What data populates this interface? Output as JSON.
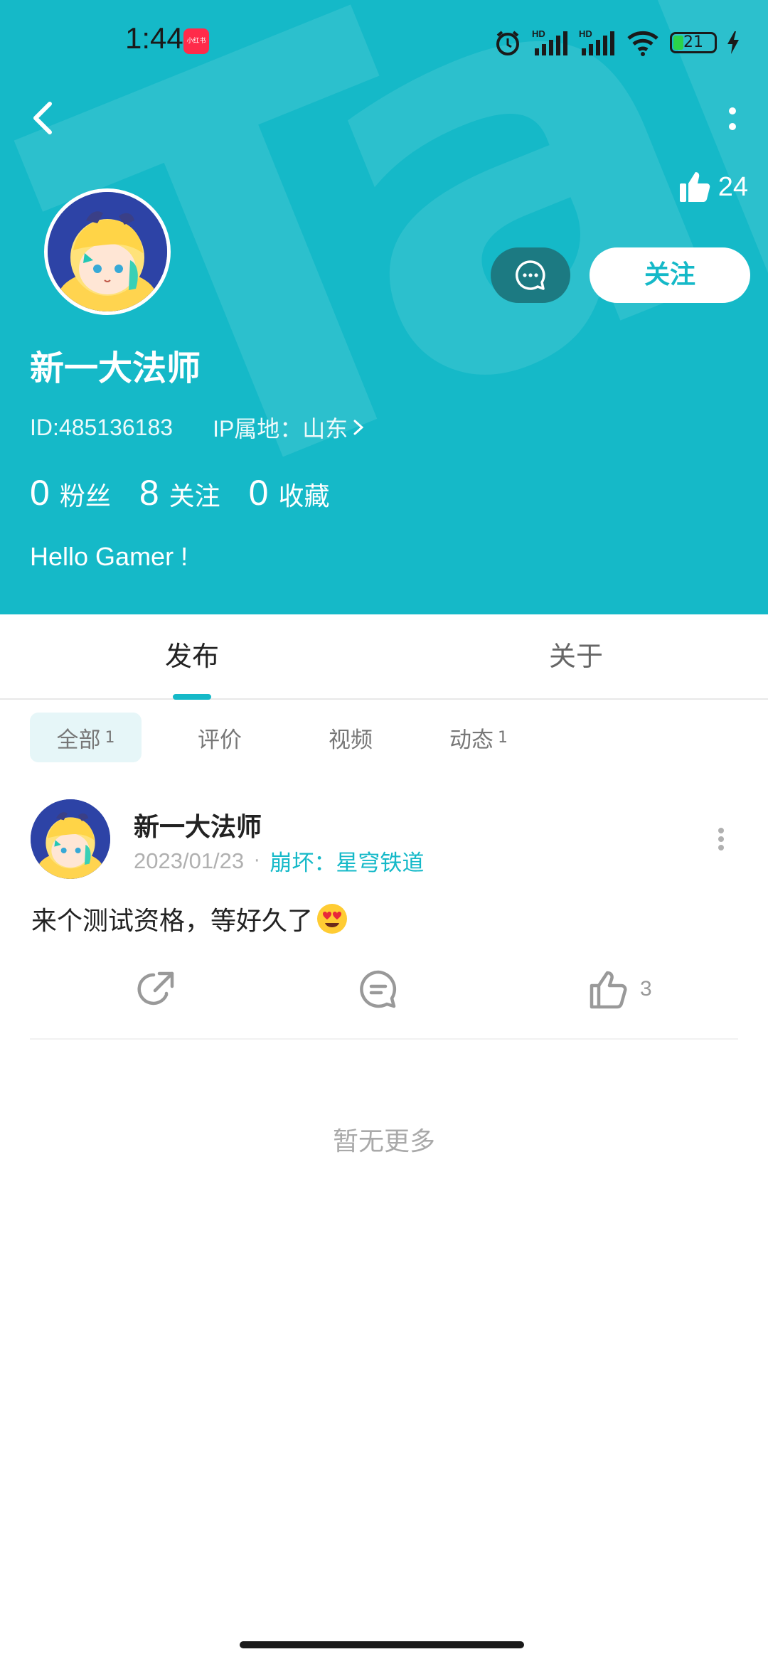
{
  "status_bar": {
    "time": "1:44",
    "app_badge": "小红书",
    "battery_level": "21",
    "network_badge": "HD"
  },
  "header": {
    "likes_count": "24",
    "follow_label": "关注",
    "username": "新一大法师",
    "user_id": "ID:485136183",
    "ip_location": "IP属地：山东",
    "stats": {
      "fans_count": "0",
      "fans_label": "粉丝",
      "following_count": "8",
      "following_label": "关注",
      "favorites_count": "0",
      "favorites_label": "收藏"
    },
    "bio": "Hello Gamer !",
    "bg_color": "#15b9c8"
  },
  "tabs": {
    "publish": "发布",
    "about": "关于"
  },
  "filters": {
    "all": "全部",
    "all_count": "1",
    "review": "评价",
    "video": "视频",
    "dynamic": "动态",
    "dynamic_count": "1"
  },
  "post": {
    "author": "新一大法师",
    "date": "2023/01/23",
    "separator": "·",
    "game": "崩坏：星穹铁道",
    "text": "来个测试资格，等好久了",
    "like_count": "3"
  },
  "footer": {
    "no_more": "暂无更多"
  }
}
